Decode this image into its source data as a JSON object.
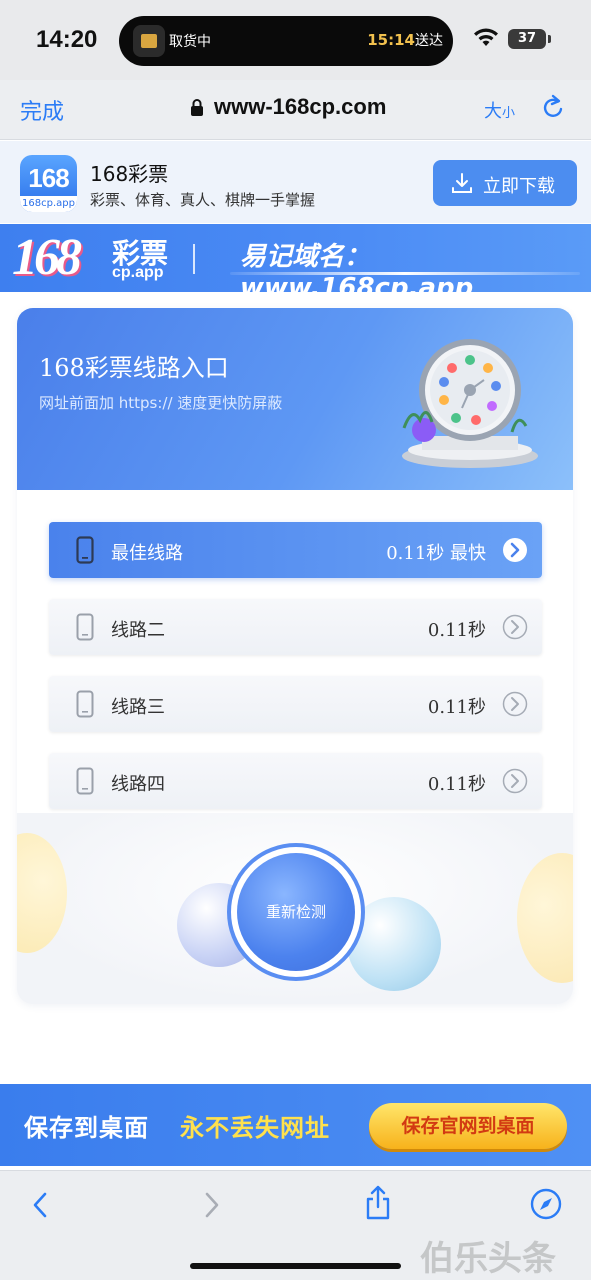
{
  "status_bar": {
    "time": "14:20",
    "island_label": "取货中",
    "island_eta_time": "15:14",
    "island_eta_suffix": "送达",
    "battery": "37"
  },
  "nav": {
    "done_label": "完成",
    "url": "www-168cp.com",
    "text_size_label": "大",
    "text_size_small": "小"
  },
  "app_banner": {
    "logo_number": "168",
    "logo_sub": "168cp.app",
    "title": "168彩票",
    "desc": "彩票、体育、真人、棋牌一手掌握",
    "download_label": "立即下载"
  },
  "brand_strip": {
    "logo_number": "168",
    "logo_name": "彩票",
    "logo_sub": "cp.app",
    "domain_text": "易记域名：www.168cp.app"
  },
  "card": {
    "title": "168彩票线路入口",
    "subtitle": "网址前面加 https:// 速度更快防屏蔽",
    "lines": [
      {
        "name": "最佳线路",
        "speed": "0.11秒 最快",
        "best": true
      },
      {
        "name": "线路二",
        "speed": "0.11秒",
        "best": false
      },
      {
        "name": "线路三",
        "speed": "0.11秒",
        "best": false
      },
      {
        "name": "线路四",
        "speed": "0.11秒",
        "best": false
      }
    ],
    "recheck_label": "重新检测"
  },
  "save_banner": {
    "text_white": "保存到桌面",
    "text_yellow": "永不丢失网址",
    "button_label": "保存官网到桌面"
  },
  "toolbar": {
    "watermark": "伯乐头条"
  },
  "colors": {
    "accent_blue": "#4c8df0",
    "link_blue": "#2b7cf6",
    "save_yellow": "#ffe14d",
    "save_button_text": "#d23a12"
  }
}
